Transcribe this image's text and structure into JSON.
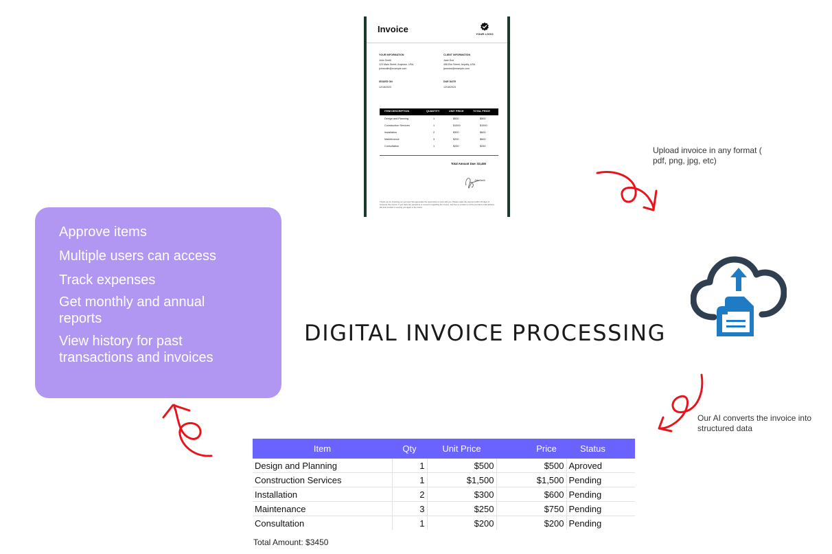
{
  "headline": "DIGITAL INVOICE PROCESSING",
  "features": [
    "Approve items",
    "Multiple users can access",
    "Track expenses",
    "Get monthly and annual reports",
    "View history for past transactions and invoices"
  ],
  "captions": {
    "upload": "Upload invoice in any format ( pdf, png, jpg, etc)",
    "convert": "Our AI converts the invoice into structured data"
  },
  "invoice_doc": {
    "title": "Invoice",
    "logo_text": "YOUR LOGO",
    "your_info_label": "YOUR INFORMATION",
    "your_name": "John Smith",
    "your_address": "123 Main Street, Anytown, USA",
    "your_email": "johnsmith@example.com",
    "client_info_label": "CLIENT INFORMATION",
    "client_name": "Jane Doe",
    "client_address": "456 Elm Street, Anycity, USA",
    "client_email": "janedoe@example.com",
    "issued_label": "ISSUED ON",
    "issued_date": "12/18/2023",
    "due_label": "DUE DATE",
    "due_date": "12/18/2023",
    "headers": [
      "ITEM DESCRIPTION",
      "QUANTITY",
      "UNIT PRICE",
      "TOTAL PRICE"
    ],
    "rows": [
      [
        "Design and Planning",
        "1",
        "$500",
        "$500"
      ],
      [
        "Construction Services",
        "1",
        "$1500",
        "$1500"
      ],
      [
        "Installation",
        "2",
        "$300",
        "$600"
      ],
      [
        "Maintenance",
        "3",
        "$200",
        "$600"
      ],
      [
        "Consultation",
        "1",
        "$250",
        "$250"
      ]
    ],
    "total": "Total Amount Due: $3,450",
    "signature_name": "John Smith",
    "footer": "Thank you for choosing our services! We appreciate the opportunity to work with you. Please make the payment within 30 days of receiving this invoice. If you have any questions or concerns regarding the invoice, feel free to contact us at the provided email address. We look forward to serving you again in the future!"
  },
  "table": {
    "headers": [
      "Item",
      "Qty",
      "Unit Price",
      "Price",
      "Status"
    ],
    "rows": [
      [
        "Design and Planning",
        "1",
        "$500",
        "$500",
        "Aproved"
      ],
      [
        "Construction Services",
        "1",
        "$1,500",
        "$1,500",
        "Pending"
      ],
      [
        "Installation",
        "2",
        "$300",
        "$600",
        "Pending"
      ],
      [
        "Maintenance",
        "3",
        "$250",
        "$750",
        "Pending"
      ],
      [
        "Consultation",
        "1",
        "$200",
        "$200",
        "Pending"
      ]
    ],
    "total": "Total Amount: $3450"
  },
  "colors": {
    "features_bg": "#b197f2",
    "table_header": "#6b63ff",
    "arrow": "#e8141c",
    "cloud_dark": "#2f3f4f",
    "cloud_blue": "#1e7bc4",
    "invoice_border": "#1b3a2b"
  },
  "icons": [
    "check-badge-icon",
    "cloud-upload-document-icon",
    "curly-arrow-icon"
  ]
}
